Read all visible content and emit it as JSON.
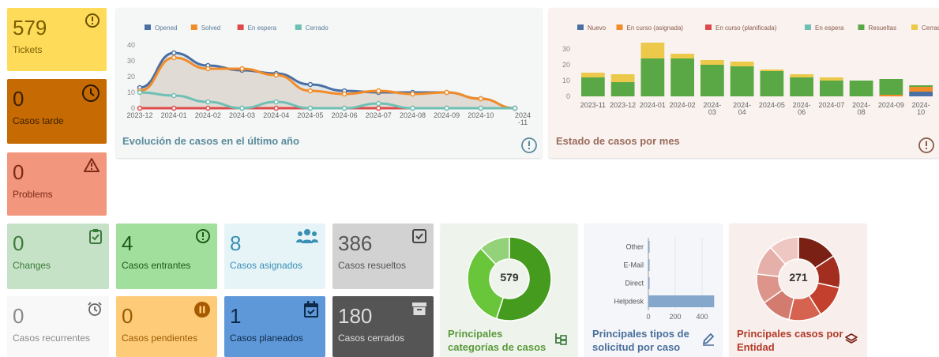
{
  "cards": {
    "tickets": {
      "value": "579",
      "label": "Tickets",
      "color": "#fedc5a"
    },
    "late": {
      "value": "0",
      "label": "Casos tarde",
      "color": "#c66a03"
    },
    "problems": {
      "value": "0",
      "label": "Problems",
      "color": "#f2967d"
    },
    "changes": {
      "value": "0",
      "label": "Changes",
      "color": "#c6e2c6"
    },
    "incoming": {
      "value": "4",
      "label": "Casos entrantes",
      "color": "#a1e09c"
    },
    "assigned": {
      "value": "8",
      "label": "Casos asignados",
      "color": "#e6f4f8"
    },
    "solved": {
      "value": "386",
      "label": "Casos resueltos",
      "color": "#d2d2d2"
    },
    "recurrent": {
      "value": "0",
      "label": "Casos recurrentes",
      "color": "#f8f8f8"
    },
    "pending": {
      "value": "0",
      "label": "Casos pendientes",
      "color": "#fecc79"
    },
    "planned": {
      "value": "1",
      "label": "Casos planeados",
      "color": "#5f98d8"
    },
    "closed": {
      "value": "180",
      "label": "Casos cerrados",
      "color": "#555555"
    }
  },
  "panels": {
    "evolution": {
      "title": "Evolución de casos en el último año"
    },
    "status": {
      "title": "Estado de casos por mes"
    },
    "categories": {
      "title": "Principales categorías de casos",
      "center": "579"
    },
    "request_types": {
      "title": "Principales tipos de solicitud por caso"
    },
    "entities": {
      "title": "Principales casos por Entidad",
      "center": "271"
    }
  },
  "chart_data": [
    {
      "type": "area",
      "x": [
        "2023-12",
        "2024-01",
        "2024-02",
        "2024-03",
        "2024-04",
        "2024-05",
        "2024-06",
        "2024-07",
        "2024-08",
        "2024-09",
        "2024-10",
        "2024-11"
      ],
      "series": [
        {
          "name": "Opened",
          "color": "#4a6fa5",
          "values": [
            13,
            35,
            27,
            24,
            22,
            15,
            11,
            10,
            10,
            10,
            6,
            0
          ]
        },
        {
          "name": "Solved",
          "color": "#f28c28",
          "values": [
            11,
            32,
            25,
            25,
            21,
            11,
            9,
            11,
            9,
            10,
            6,
            0
          ]
        },
        {
          "name": "En espera",
          "color": "#de4a4a",
          "values": [
            0,
            0,
            0,
            0,
            0,
            0,
            0,
            0,
            0,
            0,
            0,
            0
          ]
        },
        {
          "name": "Cerrado",
          "color": "#6fbfb4",
          "values": [
            10,
            8,
            4,
            0,
            4,
            0,
            0,
            3,
            0,
            0,
            0,
            0
          ]
        }
      ],
      "ylim": [
        0,
        40
      ],
      "yticks": [
        0,
        10,
        20,
        30,
        40
      ],
      "legend": "top-left"
    },
    {
      "type": "bar",
      "x": [
        "2023-11",
        "2023-12",
        "2024-01",
        "2024-02",
        "2024-03",
        "2024-04",
        "2024-05",
        "2024-06",
        "2024-07",
        "2024-08",
        "2024-09",
        "2024-10"
      ],
      "series": [
        {
          "name": "Nuevo",
          "color": "#4a6fa5",
          "values": [
            0,
            0,
            0,
            0,
            0,
            0,
            0,
            0,
            0,
            0,
            0,
            3
          ]
        },
        {
          "name": "En curso (asignada)",
          "color": "#f28c28",
          "values": [
            0,
            0,
            0,
            0,
            0,
            0,
            0,
            0,
            0,
            0,
            1,
            3
          ]
        },
        {
          "name": "En curso (planificada)",
          "color": "#de4a4a",
          "values": [
            0,
            0,
            0,
            0,
            0,
            0,
            0,
            0,
            0,
            0,
            0,
            0
          ]
        },
        {
          "name": "En espera",
          "color": "#6fbfb4",
          "values": [
            0,
            0,
            0,
            0,
            0,
            0,
            0,
            0,
            0,
            0,
            0,
            0
          ]
        },
        {
          "name": "Resueltas",
          "color": "#5aa845",
          "values": [
            12,
            9,
            24,
            24,
            20,
            19,
            16,
            12,
            10,
            10,
            10,
            1
          ]
        },
        {
          "name": "Cerrado",
          "color": "#ecc94b",
          "values": [
            3,
            5,
            10,
            3,
            3,
            3,
            1,
            2,
            2,
            0,
            0,
            0
          ]
        }
      ],
      "ylim": [
        0,
        30
      ],
      "yticks": [
        0,
        10,
        20,
        30
      ],
      "legend": "top"
    },
    {
      "type": "pie",
      "values": [
        55,
        33,
        12
      ],
      "colors": [
        "#449b1e",
        "#69c53a",
        "#94d27a"
      ]
    },
    {
      "type": "bar",
      "categories": [
        "Other",
        "E-Mail",
        "Direct",
        "Helpdesk"
      ],
      "values": [
        2,
        3,
        4,
        490
      ],
      "xticks": [
        0,
        200,
        400
      ],
      "color": "#86a7cc"
    },
    {
      "type": "pie",
      "values": [
        15,
        12,
        12,
        12,
        11,
        11,
        11,
        11
      ],
      "colors": [
        "#7b2014",
        "#a32e1f",
        "#c2402d",
        "#d66250",
        "#d37b6f",
        "#dd958b",
        "#e6b0aa",
        "#efc7c2"
      ]
    }
  ]
}
